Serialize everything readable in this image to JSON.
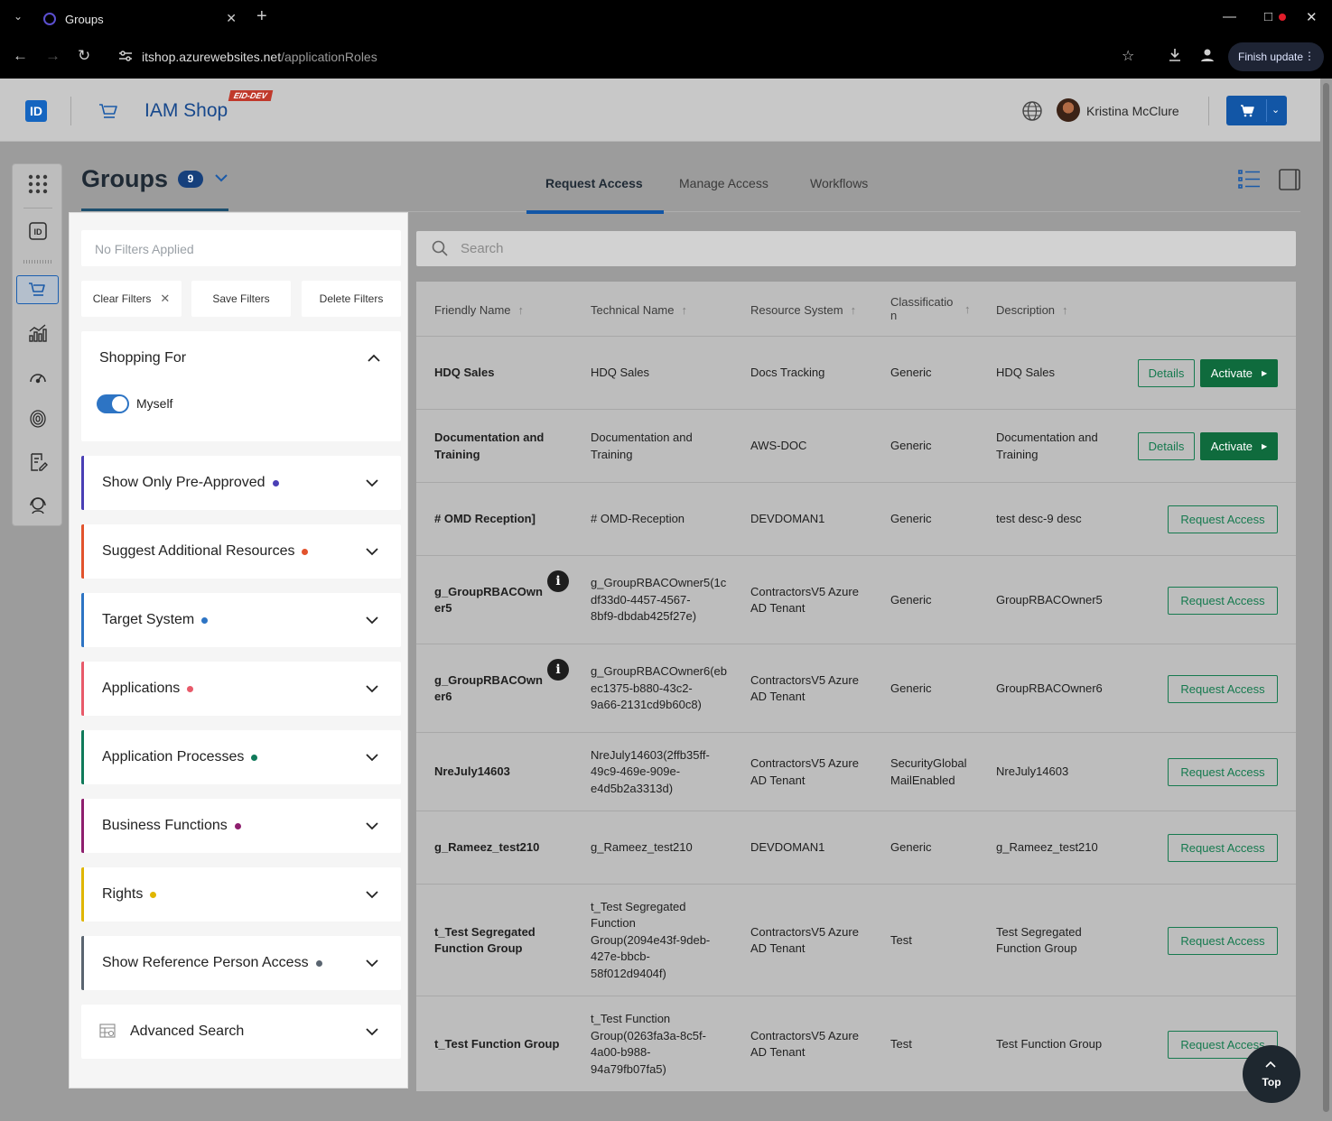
{
  "browser": {
    "tab_title": "Groups",
    "url_host": "itshop.azurewebsites.net",
    "url_path": "/applicationRoles",
    "finish_update": "Finish update"
  },
  "header": {
    "logo_text": "ID",
    "app_title": "IAM Shop",
    "env_badge": "EID-DEV",
    "user_name": "Kristina McClure"
  },
  "page": {
    "title": "Groups",
    "count": "9",
    "tabs": [
      "Request Access",
      "Manage Access",
      "Workflows"
    ],
    "active_tab": "Request Access"
  },
  "filters": {
    "summary_placeholder": "No Filters Applied",
    "clear_label": "Clear Filters",
    "save_label": "Save Filters",
    "delete_label": "Delete Filters",
    "shopping_for": {
      "title": "Shopping For",
      "toggle_label": "Myself",
      "toggle_on": true
    },
    "facets": [
      {
        "label": "Show Only Pre-Approved",
        "color": "#4a3fb5"
      },
      {
        "label": "Suggest Additional Resources",
        "color": "#e2532d"
      },
      {
        "label": "Target System",
        "color": "#2d74c4"
      },
      {
        "label": "Applications",
        "color": "#e85a6a"
      },
      {
        "label": "Application Processes",
        "color": "#107a5a"
      },
      {
        "label": "Business Functions",
        "color": "#8e1f6e"
      },
      {
        "label": "Rights",
        "color": "#e0b600"
      },
      {
        "label": "Show Reference Person Access",
        "color": "#5a6570"
      }
    ],
    "advanced_search": "Advanced Search"
  },
  "search": {
    "placeholder": "Search"
  },
  "table": {
    "columns": [
      "Friendly Name",
      "Technical Name",
      "Resource System",
      "Classification",
      "Description"
    ],
    "classification_header_lines": [
      "Classificatio",
      "n"
    ],
    "details_label": "Details",
    "activate_label": "Activate",
    "request_label": "Request Access",
    "rows": [
      {
        "friendly": [
          "HDQ Sales"
        ],
        "technical": [
          "HDQ Sales"
        ],
        "system": [
          "Docs Tracking"
        ],
        "classification": [
          "Generic"
        ],
        "description": [
          "HDQ Sales"
        ],
        "actions": "activate"
      },
      {
        "friendly": [
          "Documentation and",
          "Training"
        ],
        "technical": [
          "Documentation and",
          "Training"
        ],
        "system": [
          "AWS-DOC"
        ],
        "classification": [
          "Generic"
        ],
        "description": [
          "Documentation and",
          "Training"
        ],
        "actions": "activate"
      },
      {
        "friendly": [
          "# OMD Reception]"
        ],
        "technical": [
          "# OMD-Reception"
        ],
        "system": [
          "DEVDOMAN1"
        ],
        "classification": [
          "Generic"
        ],
        "description": [
          "test desc-9 desc"
        ],
        "actions": "request"
      },
      {
        "friendly": [
          "g_GroupRBACOwn",
          "er5"
        ],
        "technical": [
          "g_GroupRBACOwner5(1c",
          "df33d0-4457-4567-",
          "8bf9-dbdab425f27e)"
        ],
        "system": [
          "ContractorsV5 Azure",
          "AD Tenant"
        ],
        "classification": [
          "Generic"
        ],
        "description": [
          "GroupRBACOwner5"
        ],
        "actions": "request",
        "info": true
      },
      {
        "friendly": [
          "g_GroupRBACOwn",
          "er6"
        ],
        "technical": [
          "g_GroupRBACOwner6(eb",
          "ec1375-b880-43c2-",
          "9a66-2131cd9b60c8)"
        ],
        "system": [
          "ContractorsV5 Azure",
          "AD Tenant"
        ],
        "classification": [
          "Generic"
        ],
        "description": [
          "GroupRBACOwner6"
        ],
        "actions": "request",
        "info": true
      },
      {
        "friendly": [
          "NreJuly14603"
        ],
        "technical": [
          "NreJuly14603(2ffb35ff-",
          "49c9-469e-909e-",
          "e4d5b2a3313d)"
        ],
        "system": [
          "ContractorsV5 Azure",
          "AD Tenant"
        ],
        "classification": [
          "SecurityGlobal",
          "MailEnabled"
        ],
        "description": [
          "NreJuly14603"
        ],
        "actions": "request"
      },
      {
        "friendly": [
          "g_Rameez_test210"
        ],
        "technical": [
          "g_Rameez_test210"
        ],
        "system": [
          "DEVDOMAN1"
        ],
        "classification": [
          "Generic"
        ],
        "description": [
          "g_Rameez_test210"
        ],
        "actions": "request"
      },
      {
        "friendly": [
          "t_Test Segregated",
          "Function Group"
        ],
        "technical": [
          "t_Test Segregated",
          "Function",
          "Group(2094e43f-9deb-",
          "427e-bbcb-",
          "58f012d9404f)"
        ],
        "system": [
          "ContractorsV5 Azure",
          "AD Tenant"
        ],
        "classification": [
          "Test"
        ],
        "description": [
          "Test Segregated",
          "Function Group"
        ],
        "actions": "request"
      },
      {
        "friendly": [
          "t_Test Function Group"
        ],
        "technical": [
          "t_Test Function",
          "Group(0263fa3a-8c5f-",
          "4a00-b988-",
          "94a79fb07fa5)"
        ],
        "system": [
          "ContractorsV5 Azure",
          "AD Tenant"
        ],
        "classification": [
          "Test"
        ],
        "description": [
          "Test Function Group"
        ],
        "actions": "request"
      }
    ]
  },
  "top_button": "Top"
}
